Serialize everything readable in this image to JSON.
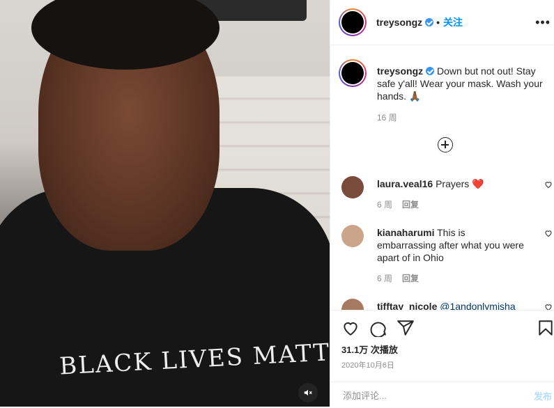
{
  "post": {
    "username": "treysongz",
    "follow_label": "关注",
    "more_icon": "more-horizontal-icon"
  },
  "media": {
    "shirt_text": "BLACK LIVES MATTER",
    "mute_icon": "speaker-muted-icon"
  },
  "caption": {
    "username": "treysongz",
    "text": "Down but not out! Stay safe y'all! Wear your mask. Wash your hands. 🙏🏾",
    "time": "16 周"
  },
  "comments": [
    {
      "username": "laura.veal16",
      "text": "Prayers ❤️",
      "time": "6 周",
      "reply": "回复",
      "avatar_color": "#7a4b3a"
    },
    {
      "username": "kianaharumi",
      "text": "This is embarrassing after what you were apart of in Ohio",
      "time": "6 周",
      "reply": "回复",
      "avatar_color": "#caa58a"
    },
    {
      "username": "tifftay_nicole",
      "text": "@1andonlymisha",
      "time": "",
      "reply": "",
      "avatar_color": "#a57a60"
    }
  ],
  "actions": {
    "likes": "31.1万 次播放",
    "date": "2020年10月6日"
  },
  "add_comment": {
    "placeholder": "添加评论...",
    "post_label": "发布"
  },
  "colors": {
    "accent": "#0095f6",
    "verified": "#3897f0",
    "muted_text": "#8e8e8e"
  }
}
